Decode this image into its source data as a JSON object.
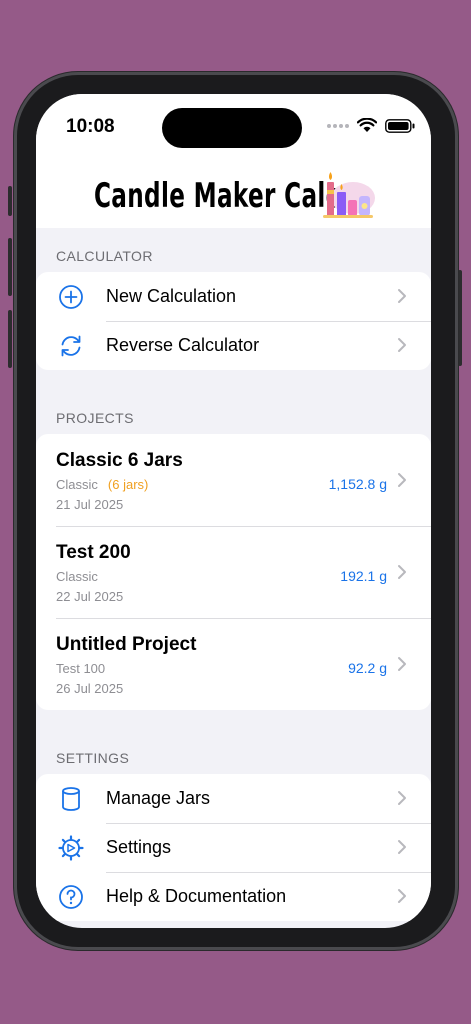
{
  "status": {
    "time": "10:08"
  },
  "app": {
    "title": "Candle Maker Calc"
  },
  "calculator": {
    "header": "CALCULATOR",
    "items": [
      {
        "label": "New Calculation",
        "icon": "plus-circle-icon"
      },
      {
        "label": "Reverse Calculator",
        "icon": "refresh-icon"
      }
    ]
  },
  "projects": {
    "header": "PROJECTS",
    "items": [
      {
        "name": "Classic 6 Jars",
        "type": "Classic",
        "jars": "(6 jars)",
        "date": "21 Jul 2025",
        "weight": "1,152.8 g"
      },
      {
        "name": "Test 200",
        "type": "Classic",
        "jars": "",
        "date": "22 Jul 2025",
        "weight": "192.1 g"
      },
      {
        "name": "Untitled Project",
        "type": "Test 100",
        "jars": "",
        "date": "26 Jul 2025",
        "weight": "92.2 g"
      }
    ]
  },
  "settings": {
    "header": "SETTINGS",
    "items": [
      {
        "label": "Manage Jars",
        "icon": "jar-icon"
      },
      {
        "label": "Settings",
        "icon": "gear-icon"
      },
      {
        "label": "Help & Documentation",
        "icon": "question-circle-icon"
      }
    ]
  },
  "colors": {
    "accent": "#1a73e8",
    "jar_badge": "#f0a020",
    "background": "#955a88"
  }
}
